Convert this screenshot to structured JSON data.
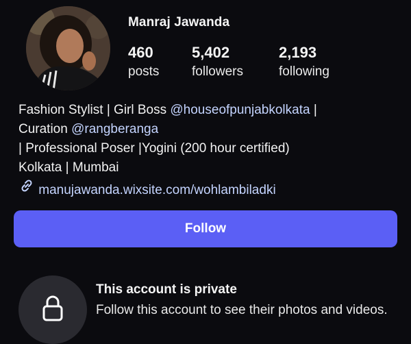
{
  "profile": {
    "username": "Manraj Jawanda",
    "avatar_icon": "profile-photo"
  },
  "stats": {
    "posts": {
      "value": "460",
      "label": "posts"
    },
    "followers": {
      "value": "5,402",
      "label": "followers"
    },
    "following": {
      "value": "2,193",
      "label": "following"
    }
  },
  "bio": {
    "line1_text": "Fashion Stylist | Girl Boss ",
    "line1_mention": "@houseofpunjabkolkata",
    "line1_end": " |",
    "line2_text": "Curation ",
    "line2_mention": "@rangberanga",
    "line3": "| Professional Poser |Yogini (200 hour certified)",
    "line4": "Kolkata | Mumbai",
    "link": "manujawanda.wixsite.com/wohlambiladki",
    "link_icon": "link-icon"
  },
  "follow_button": {
    "label": "Follow"
  },
  "private_notice": {
    "icon": "lock-icon",
    "title": "This account is private",
    "text": "Follow this account to see their photos and videos."
  },
  "colors": {
    "background": "#0b0b0f",
    "accent": "#5b5ff5",
    "mention": "#c4d4ff"
  }
}
